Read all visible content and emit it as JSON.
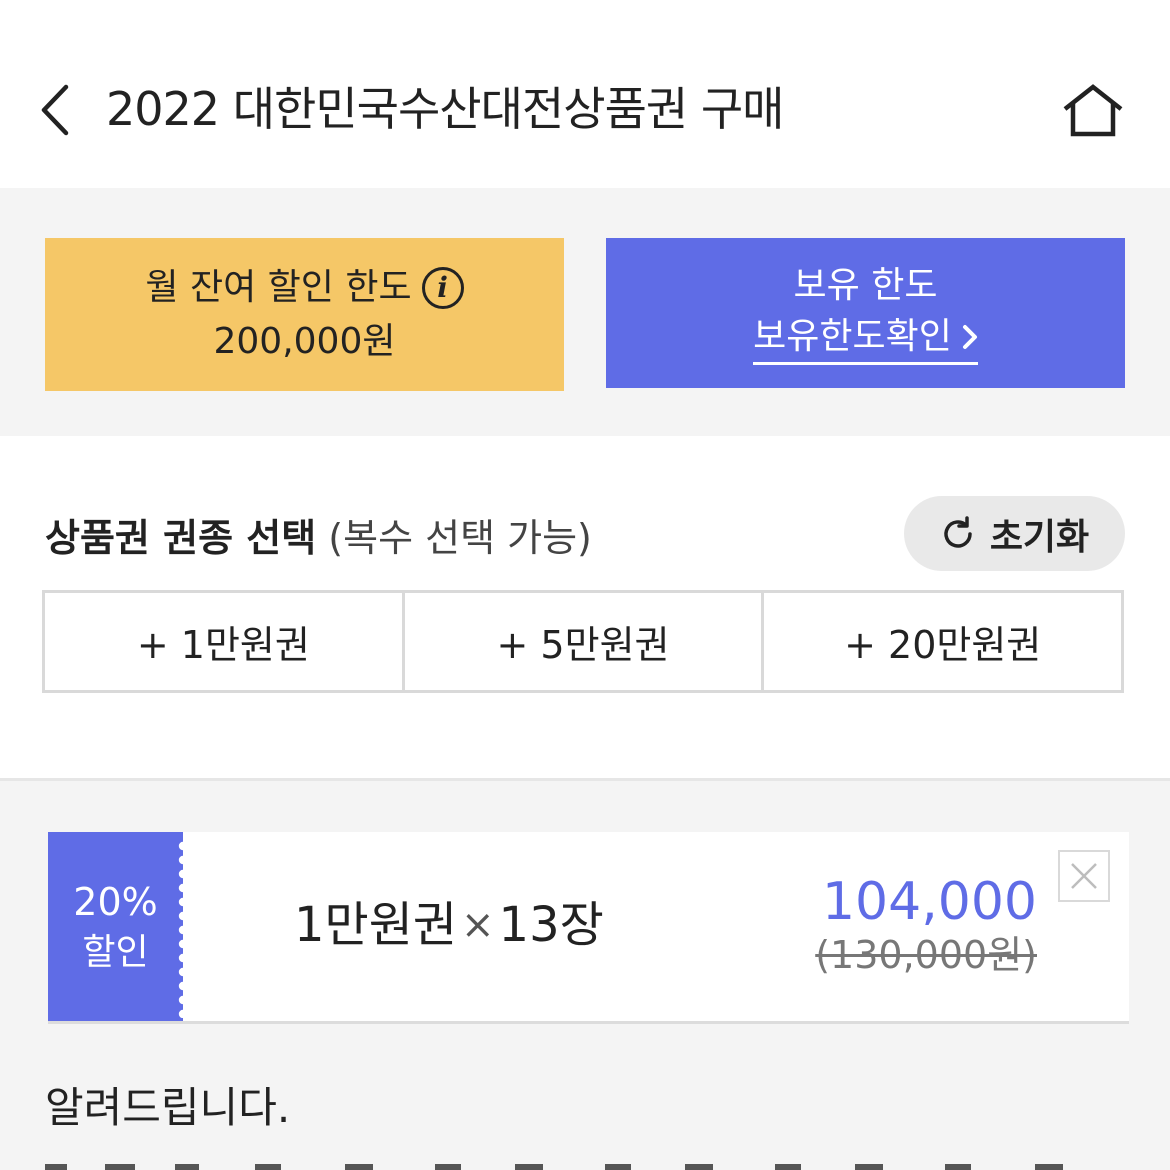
{
  "header": {
    "title": "2022 대한민국수산대전상품권 구매",
    "back_icon": "chevron-left-icon",
    "home_icon": "home-icon"
  },
  "limits": {
    "monthly_label": "월 잔여 할인 한도",
    "monthly_value": "200,000원",
    "info_glyph": "i",
    "holding_label": "보유 한도",
    "holding_link": "보유한도확인",
    "holding_link_arrow": "›"
  },
  "selection": {
    "title_bold": "상품권 권종 선택",
    "title_sub": "(복수 선택 가능)",
    "reset_label": "초기화",
    "denominations": [
      "+ 1만원권",
      "+ 5만원권",
      "+ 20만원권"
    ]
  },
  "ticket": {
    "discount_pct": "20%",
    "discount_label": "할인",
    "name": "1만원권",
    "times": "×",
    "quantity": "13장",
    "price": "104,000",
    "original_price": "(130,000원)"
  },
  "notice": {
    "title": "알려드립니다."
  },
  "colors": {
    "accent_blue": "#5f6ce6",
    "accent_yellow": "#f5c767",
    "background": "#f4f4f4"
  }
}
